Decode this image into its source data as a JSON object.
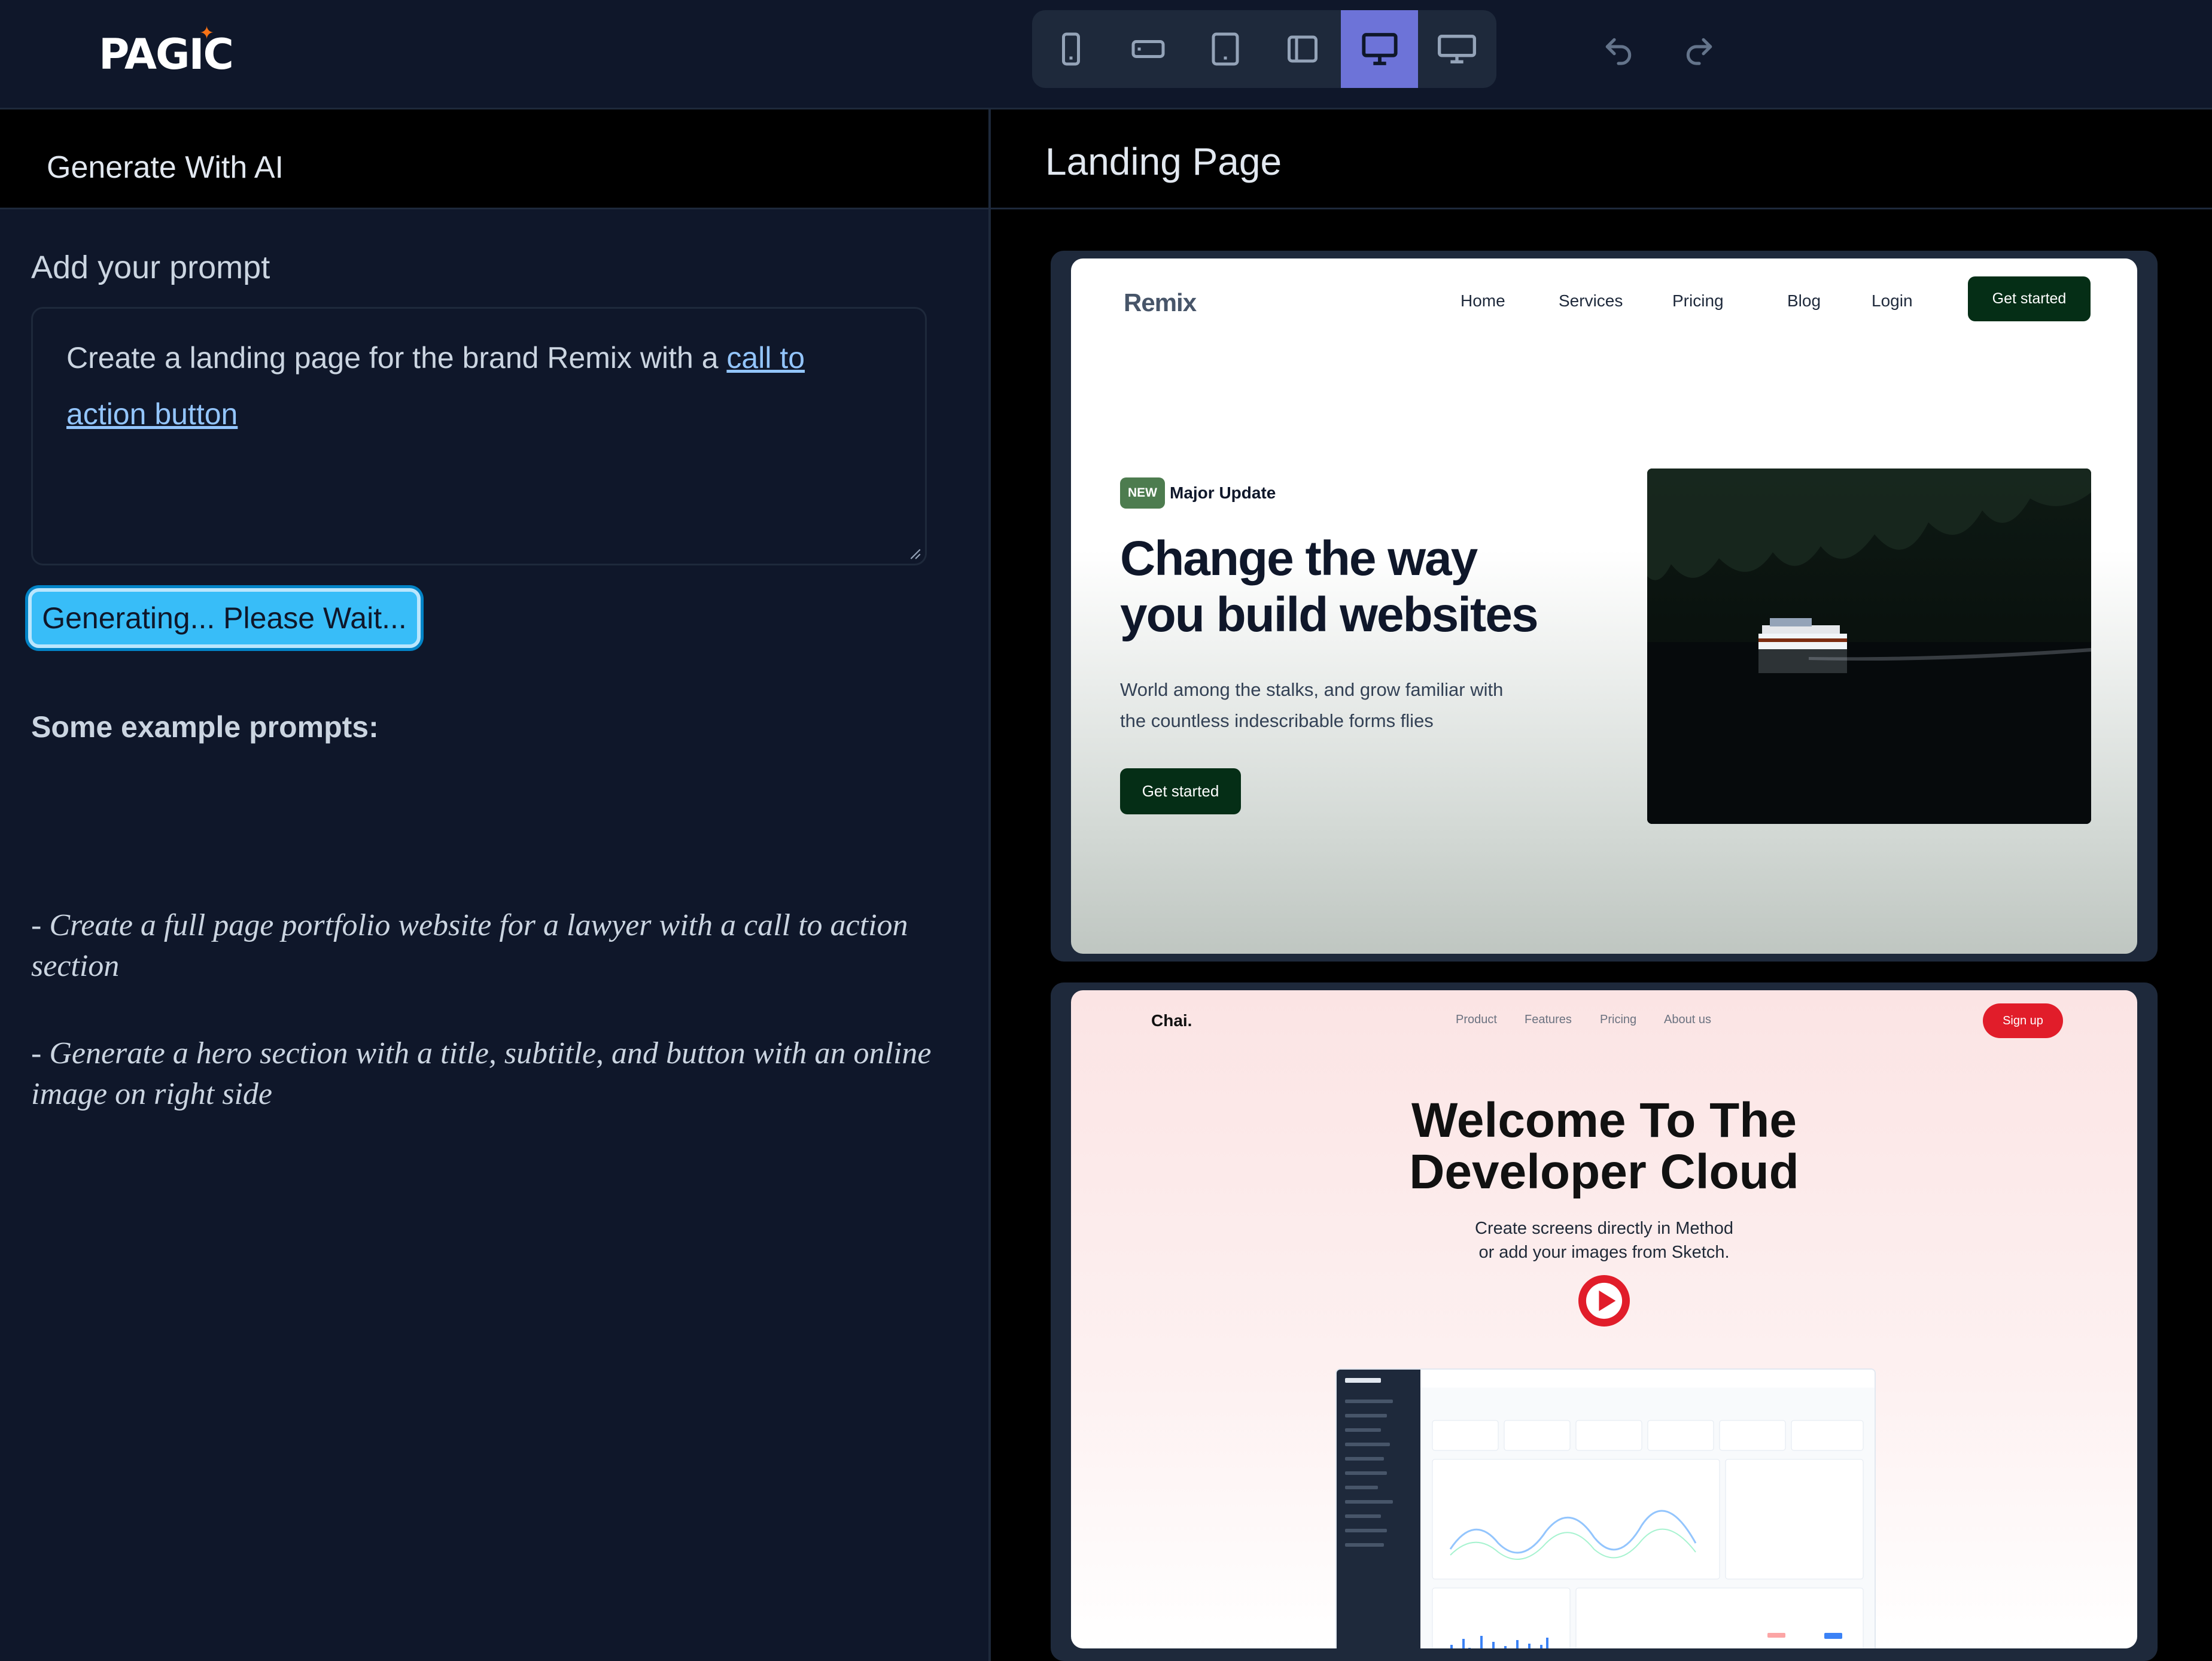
{
  "app": {
    "logo": "PAGIC",
    "device_buttons": [
      {
        "name": "phone-portrait-icon",
        "active": false
      },
      {
        "name": "phone-landscape-icon",
        "active": false
      },
      {
        "name": "tablet-portrait-icon",
        "active": false
      },
      {
        "name": "tablet-landscape-icon",
        "active": false
      },
      {
        "name": "desktop-icon",
        "active": true
      },
      {
        "name": "wide-desktop-icon",
        "active": false
      }
    ],
    "undo_icon": "undo-icon",
    "redo_icon": "redo-icon",
    "accent_color": "#6d73d8"
  },
  "left_panel": {
    "title": "Generate With AI",
    "prompt_label": "Add your prompt",
    "prompt_value_prefix": "Create a landing page for the brand Remix with a ",
    "prompt_value_link": "call to action button",
    "generate_button": "Generating... Please Wait...",
    "examples_title": "Some example prompts:",
    "examples": [
      "- Create a full page portfolio website for a lawyer with a call to action section",
      "- Generate a hero section with a title, subtitle, and button with an online image on right side"
    ]
  },
  "right_panel": {
    "title": "Landing Page",
    "templates": [
      {
        "brand": "Remix",
        "nav": [
          "Home",
          "Services",
          "Pricing",
          "Blog",
          "Login"
        ],
        "cta_top": "Get started",
        "badge": "NEW",
        "badge_text": "Major Update",
        "headline_line1": "Change the way",
        "headline_line2": "you build websites",
        "subtitle_line1": "World among the stalks, and grow familiar with",
        "subtitle_line2": "the countless indescribable forms flies",
        "cta": "Get started"
      },
      {
        "brand": "Chai.",
        "nav": [
          "Product",
          "Features",
          "Pricing",
          "About us"
        ],
        "cta_top": "Sign up",
        "headline_line1": "Welcome To The",
        "headline_line2": "Developer Cloud",
        "subtitle_line1": "Create screens directly in Method",
        "subtitle_line2": "or add your images from Sketch."
      }
    ]
  }
}
